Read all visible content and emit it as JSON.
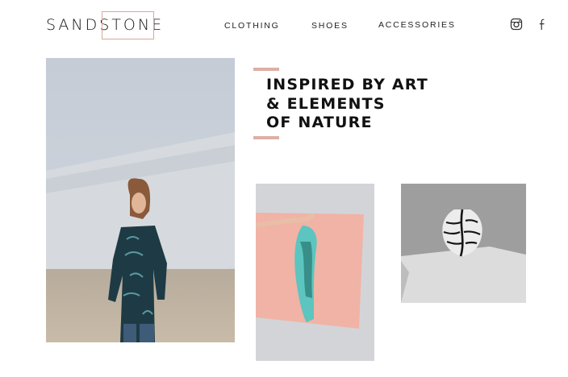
{
  "brand": {
    "logo_text": "SANDSTONE"
  },
  "nav": {
    "items": [
      {
        "label": "CLOTHING"
      },
      {
        "label": "SHOES"
      },
      {
        "label": "ACCESSORIES"
      }
    ]
  },
  "social": {
    "icons": [
      "instagram-icon",
      "facebook-icon"
    ]
  },
  "hero": {
    "headline_lines": [
      "INSPIRED BY ART",
      "& ELEMENTS",
      "OF NATURE"
    ]
  },
  "colors": {
    "accent": "#dcb0a4",
    "logo_box": "#d9a89a",
    "text": "#111111",
    "pink_backdrop": "#f0b3a5",
    "scarf": "#5cc5bf"
  }
}
